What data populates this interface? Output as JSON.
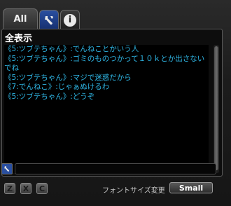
{
  "tabs": {
    "all_label": "All",
    "tool_icon": "wrench-icon",
    "info_icon": "info-icon",
    "info_glyph": "i"
  },
  "chat": {
    "title": "全表示",
    "lines": [
      {
        "text": "《5:ツブテちゃん》:でんねことかいう人",
        "color": "#2fb7e6"
      },
      {
        "text": "《5:ツブテちゃん》:ゴミのものつかって１０ｋとか出さないでね",
        "color": "#2fb7e6"
      },
      {
        "text": "《5:ツブテちゃん》:マジで迷惑だから",
        "color": "#2fb7e6"
      },
      {
        "text": "《7:でんねこ》:じゃぁぬけるわ",
        "color": "#2fb7e6"
      },
      {
        "text": "《5:ツブテちゃん》:どうぞ",
        "color": "#2fb7e6"
      }
    ]
  },
  "input": {
    "value": "",
    "placeholder": ""
  },
  "footer": {
    "keys": [
      "Z",
      "X",
      "C"
    ],
    "font_size_label": "フォントサイズ変更",
    "font_size_button": "Small"
  },
  "colors": {
    "chat_text": "#2fb7e6",
    "accent_tab": "#2a4fa0"
  }
}
